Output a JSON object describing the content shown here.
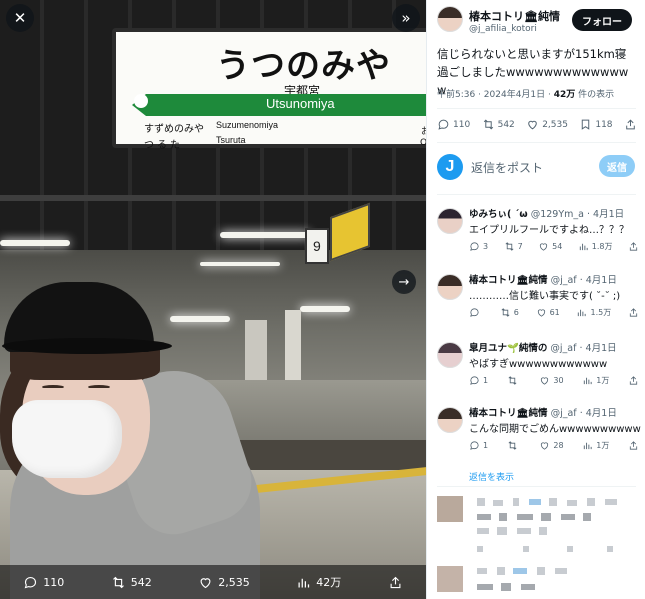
{
  "media": {
    "close_icon": "close-icon",
    "next_icon": "double-chevron-right-icon",
    "arrow_icon": "chevron-right-icon",
    "sign": {
      "hiragana": "うつのみや",
      "kanji": "宇都宮",
      "romaji": "Utsunomiya",
      "prev_jp": "すずめのみや",
      "prev_jp2": "つるた",
      "prev_romaji": "Suzumenomiya",
      "prev_romaji2": "Tsuruta",
      "next_fragment": "お",
      "next_fragment2": "Ok"
    },
    "platform_number": "9",
    "bar": {
      "replies": "110",
      "reposts": "542",
      "likes": "2,535",
      "views": "42万"
    }
  },
  "tweet": {
    "author_name": "椿本コトリ🏛純情",
    "author_handle": "@j_afilia_kotori",
    "follow_label": "フォロー",
    "text": "信じられないと思いますが151km寝過ごしましたwwwwwwwwwwwwww",
    "time": "午前5:36 · 2024年4月1日 · ",
    "views_count": "42万",
    "views_label": " 件の表示",
    "replies": "110",
    "reposts": "542",
    "likes": "2,535",
    "bookmarks": "118"
  },
  "reply_box": {
    "placeholder": "返信をポスト",
    "button": "返信"
  },
  "replies": [
    {
      "name": "ゆみちぃ( ´ω",
      "handle": "@129Ym_a",
      "date": "4月1日",
      "text": "エイプリルフールですよね…？？？",
      "replies": "3",
      "reposts": "7",
      "likes": "54",
      "views": "1.8万"
    },
    {
      "name": "椿本コトリ🏛純情",
      "handle": "@j_af",
      "date": "4月1日",
      "text": "…………信じ難い事実です( ˘-˘ ;)",
      "replies": "",
      "reposts": "6",
      "likes": "61",
      "views": "1.5万"
    },
    {
      "name": "皐月ユナ🌱純情の",
      "handle": "@j_af",
      "date": "4月1日",
      "text": "やばすぎwwwwwwwwwwww",
      "replies": "1",
      "reposts": "",
      "likes": "30",
      "views": "1万"
    },
    {
      "name": "椿本コトリ🏛純情",
      "handle": "@j_af",
      "date": "4月1日",
      "text": "こんな同期でごめんwwwwwwwwww",
      "replies": "1",
      "reposts": "",
      "likes": "28",
      "views": "1万"
    }
  ],
  "show_replies": "返信を表示",
  "colors": {
    "accent": "#1d9bf0",
    "reply_button": "#8ecdf7",
    "sign_green": "#1e8a3b",
    "text": "#0f1419",
    "muted": "#536471"
  }
}
